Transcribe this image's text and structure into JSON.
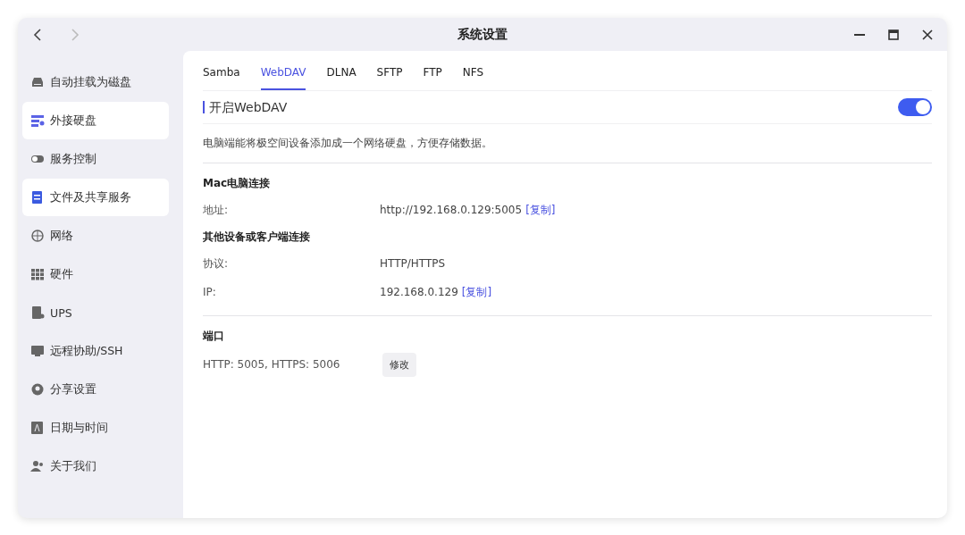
{
  "window": {
    "title": "系统设置"
  },
  "sidebar": {
    "items": [
      {
        "label": "自动挂载为磁盘",
        "selected": false
      },
      {
        "label": "外接硬盘",
        "selected": true
      },
      {
        "label": "服务控制",
        "selected": false
      },
      {
        "label": "文件及共享服务",
        "selected": true
      },
      {
        "label": "网络",
        "selected": false
      },
      {
        "label": "硬件",
        "selected": false
      },
      {
        "label": "UPS",
        "selected": false
      },
      {
        "label": "远程协助/SSH",
        "selected": false
      },
      {
        "label": "分享设置",
        "selected": false
      },
      {
        "label": "日期与时间",
        "selected": false
      },
      {
        "label": "关于我们",
        "selected": false
      }
    ]
  },
  "tabs": [
    {
      "label": "Samba",
      "selected": false
    },
    {
      "label": "WebDAV",
      "selected": true
    },
    {
      "label": "DLNA",
      "selected": false
    },
    {
      "label": "SFTP",
      "selected": false
    },
    {
      "label": "FTP",
      "selected": false
    },
    {
      "label": "NFS",
      "selected": false
    }
  ],
  "toggle": {
    "label": "开启WebDAV",
    "on": true
  },
  "description": "电脑端能将极空间设备添加成一个网络硬盘，方便存储数据。",
  "sections": [
    {
      "heading": "Mac电脑连接",
      "rows": [
        {
          "label": "地址:",
          "value": "http://192.168.0.129:5005",
          "link": "[复制]"
        }
      ]
    },
    {
      "heading": "其他设备或客户端连接",
      "rows": [
        {
          "label": "协议:",
          "value": "HTTP/HTTPS"
        },
        {
          "label": "IP:",
          "value": "192.168.0.129",
          "link": "[复制]"
        }
      ]
    }
  ],
  "port": {
    "heading": "端口",
    "value": "HTTP: 5005, HTTPS: 5006",
    "button": "修改"
  }
}
